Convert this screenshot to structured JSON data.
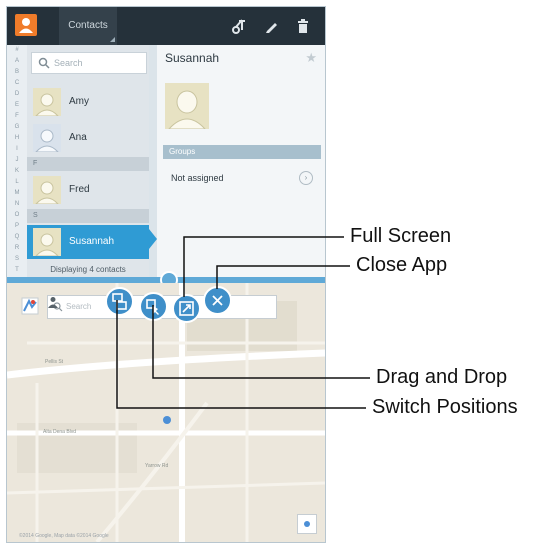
{
  "contacts": {
    "app_title": "Contacts",
    "search_placeholder": "Search",
    "index_letters": [
      "#",
      "A",
      "B",
      "C",
      "D",
      "E",
      "F",
      "G",
      "H",
      "I",
      "J",
      "K",
      "L",
      "M",
      "N",
      "O",
      "P",
      "Q",
      "R",
      "S",
      "T",
      "U",
      "V"
    ],
    "rows": [
      {
        "name": "Amy"
      },
      {
        "name": "Ana"
      },
      {
        "name": "Fred"
      },
      {
        "name": "Susannah"
      }
    ],
    "section_headers": [
      "F",
      "S"
    ],
    "count_text": "Displaying 4 contacts"
  },
  "detail": {
    "name": "Susannah",
    "groups_label": "Groups",
    "groups_value": "Not assigned"
  },
  "map": {
    "search_placeholder": "Search",
    "labels": [
      "Pellis St",
      "Alta Dena Blvd",
      "Yarrow Rd"
    ],
    "copyright": "©2014 Google, Map data ©2014 Google"
  },
  "callouts": {
    "full_screen": "Full Screen",
    "close_app": "Close App",
    "drag_and_drop": "Drag and Drop",
    "switch_positions": "Switch Positions"
  },
  "colors": {
    "accent": "#2f9bd4",
    "action_bar": "#25313a",
    "app_icon": "#f07c2a",
    "control": "#3f8fc9"
  },
  "icons": [
    "contacts-app-icon",
    "merge-icon",
    "edit-icon",
    "delete-icon",
    "search-icon",
    "star-icon",
    "person-icon",
    "locate-icon",
    "switch-positions-icon",
    "drag-drop-icon",
    "full-screen-icon",
    "close-icon"
  ]
}
